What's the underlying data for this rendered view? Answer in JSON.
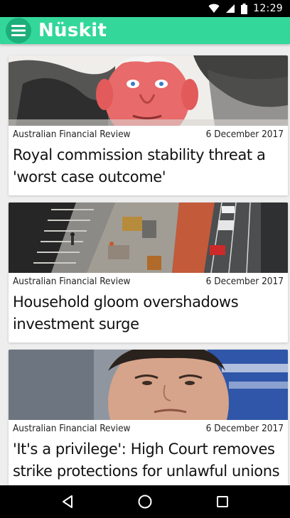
{
  "status_bar": {
    "time": "12:29",
    "icons": [
      "wifi-icon",
      "cell-signal-icon",
      "battery-icon"
    ]
  },
  "app_bar": {
    "title": "Nüskit",
    "color": "#33d79a"
  },
  "articles": [
    {
      "source": "Australian Financial Review",
      "date": "6 December 2017",
      "title": "Royal commission stability threat a 'worst case outcome'"
    },
    {
      "source": "Australian Financial Review",
      "date": "6 December 2017",
      "title": "Household gloom overshadows investment surge"
    },
    {
      "source": "Australian Financial Review",
      "date": "6 December 2017",
      "title": "'It's a privilege': High Court removes strike protections for unlawful unions"
    }
  ],
  "nav_bar": {
    "icons": [
      "back-icon",
      "home-icon",
      "recents-icon"
    ]
  }
}
